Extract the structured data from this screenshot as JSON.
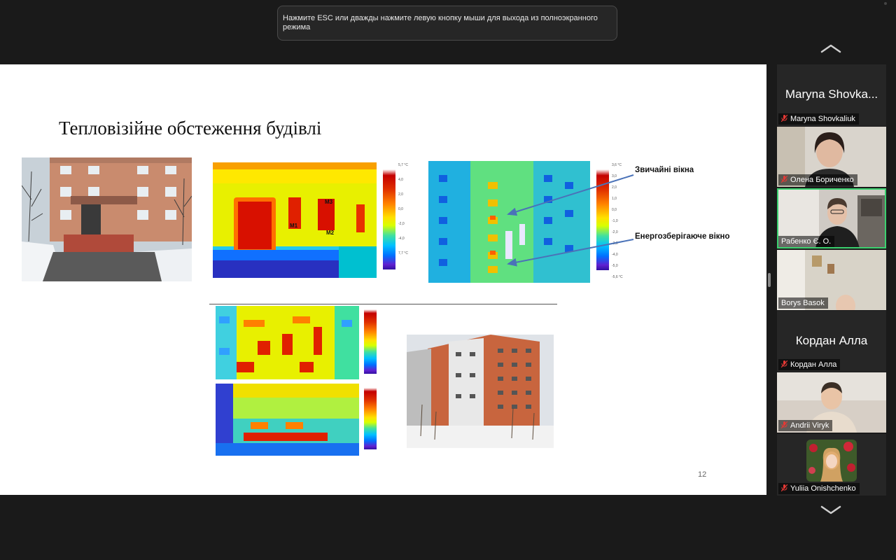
{
  "toast": {
    "text": "Нажмите ESC или дважды нажмите левую кнопку мыши для выхода из полноэкранного режима"
  },
  "slide": {
    "title": "Тепловізійне обстеження будівлі",
    "page_number": "12",
    "label_normal_windows": "Звичайні вікна",
    "label_energy_window": "Енергозберігаюче вікно",
    "thermal1_scale": [
      "5,7 °C",
      "4,0",
      "2,0",
      "0,0",
      "-2,0",
      "-4,0",
      "7,7 °C"
    ],
    "thermal2_scale": [
      "3,6 °C",
      "3,0",
      "2,0",
      "1,0",
      "0,0",
      "-1,0",
      "-2,0",
      "-3,0",
      "-4,0",
      "-5,0",
      "-5,6 °C"
    ],
    "markers": [
      "M1",
      "M2",
      "M3"
    ]
  },
  "participants": [
    {
      "display": "Maryna Shovka...",
      "name": "Maryna Shovkaliuk",
      "video": false
    },
    {
      "name": "Олена Бориченко",
      "video": true
    },
    {
      "name": "Рабенко Є. О.",
      "video": true,
      "active": true
    },
    {
      "name": "Borys Basok",
      "video": true
    },
    {
      "display": "Кордан Алла",
      "name": "Кордан Алла",
      "video": false
    },
    {
      "name": "Andrii Viryk",
      "video": true
    },
    {
      "name": "Yuliia Onishchenko",
      "video": true
    }
  ],
  "colors": {
    "active_speaker": "#3bd16f",
    "muted_mic": "#e53935",
    "arrow": "#4a72b8"
  }
}
